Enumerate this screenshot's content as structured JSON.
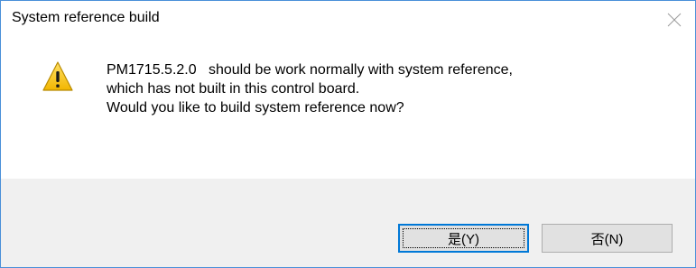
{
  "dialog": {
    "title": "System reference build",
    "message_lines": [
      "PM1715.5.2.0   should be work normally with system reference,",
      "which has not built in this control board.",
      "Would you like to build system reference now?"
    ],
    "icon": "warning-icon",
    "close_icon": "close-icon"
  },
  "buttons": {
    "yes_label": "是(Y)",
    "no_label": "否(N)"
  },
  "colors": {
    "border": "#4a90d9",
    "footer_bg": "#f0f0f0",
    "button_bg": "#e1e1e1",
    "default_button_border": "#0078d7",
    "warning_yellow": "#f9c80e"
  }
}
